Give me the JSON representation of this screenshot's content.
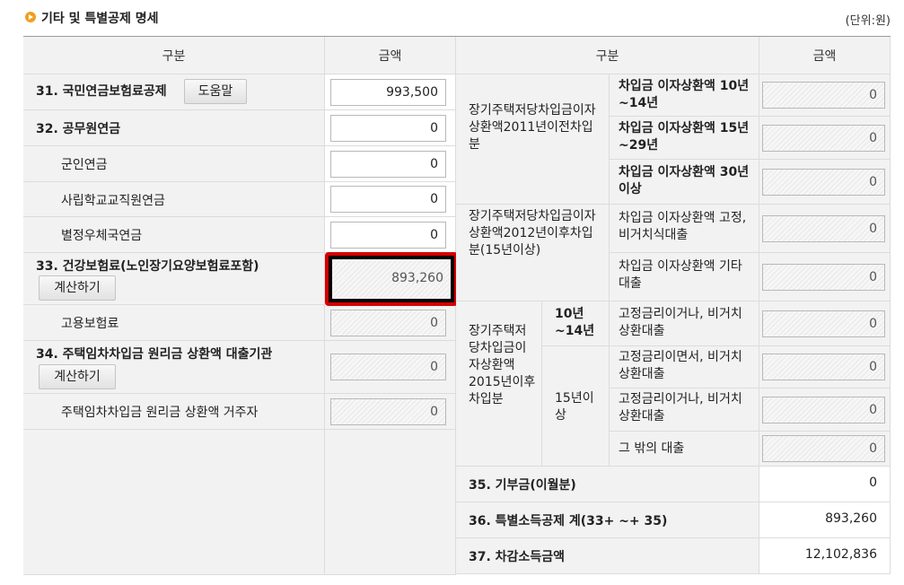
{
  "title": "기타 및 특별공제 명세",
  "unit": "(단위:원)",
  "left_headers": {
    "category": "구분",
    "amount": "금액"
  },
  "right_headers": {
    "category": "구분",
    "amount": "금액"
  },
  "left_rows": {
    "r31_label": "31. 국민연금보험료공제",
    "r31_button": "도움말",
    "r31_value": "993,500",
    "r32_label": "32. 공무원연금",
    "r32_value": "0",
    "military_label": "군인연금",
    "military_value": "0",
    "private_school_label": "사립학교교직원연금",
    "private_school_value": "0",
    "postal_label": "별정우체국연금",
    "postal_value": "0",
    "r33_label": "33. 건강보험료(노인장기요양보험료포함)",
    "r33_button": "계산하기",
    "r33_value": "893,260",
    "employment_label": "고용보험료",
    "employment_value": "0",
    "r34_label": "34. 주택임차차입금 원리금 상환액 대출기관",
    "r34_button": "계산하기",
    "r34_value": "0",
    "resident_label": "주택임차차입금 원리금 상환액 거주자",
    "resident_value": "0"
  },
  "right_rows": {
    "group2011": "장기주택저당차입금이자상환액2011년이전차입분",
    "g2011_a": "차입금 이자상환액 10년~14년",
    "g2011_a_value": "0",
    "g2011_b": "차입금 이자상환액 15년~29년",
    "g2011_b_value": "0",
    "g2011_c": "차입금 이자상환액 30년 이상",
    "g2011_c_value": "0",
    "group2012": "장기주택저당차입금이자상환액2012년이후차입분(15년이상)",
    "g2012_a": "차입금 이자상환액 고정,비거치식대출",
    "g2012_a_value": "0",
    "g2012_b": "차입금 이자상환액 기타대출",
    "g2012_b_value": "0",
    "group2015": "장기주택저당차입금이자상환액2015년이후차입분",
    "sub_10_14": "10년~14년",
    "g2015_a": "고정금리이거나, 비거치상환대출",
    "g2015_a_value": "0",
    "sub_15": "15년이상",
    "g2015_b": "고정금리이면서, 비거치상환대출",
    "g2015_b_value": "0",
    "g2015_c": "고정금리이거나, 비거치상환대출",
    "g2015_c_value": "0",
    "g2015_d": "그 밖의 대출",
    "g2015_d_value": "0",
    "r35_label": "35. 기부금(이월분)",
    "r35_value": "0",
    "r36_label": "36. 특별소득공제 계(33+ ~+ 35)",
    "r36_value": "893,260",
    "r37_label": "37. 차감소득금액",
    "r37_value": "12,102,836"
  }
}
